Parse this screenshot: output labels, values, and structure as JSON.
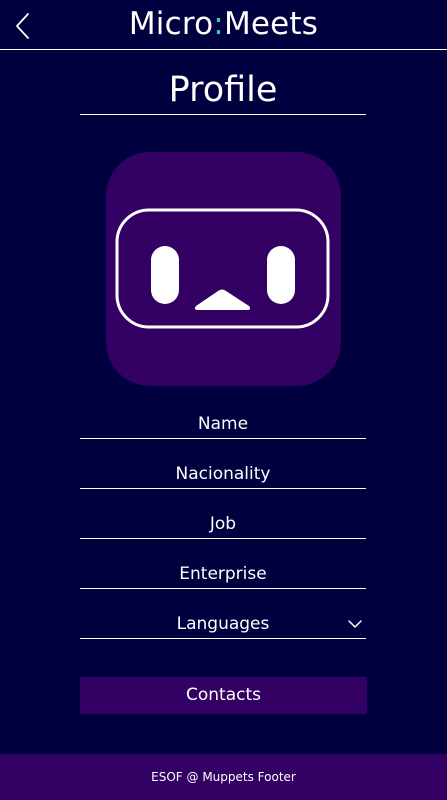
{
  "header": {
    "app_name_part1": "Micro",
    "app_name_colon": ":",
    "app_name_part2": "Meets",
    "back_icon": "chevron-left-icon"
  },
  "page": {
    "title": "Profile"
  },
  "avatar": {
    "icon": "robot-face-icon",
    "background_color": "#330064"
  },
  "fields": {
    "name": "Name",
    "nationality": "Nacionality",
    "job": "Job",
    "enterprise": "Enterprise",
    "languages": "Languages"
  },
  "contacts_button": {
    "label": "Contacts"
  },
  "footer": {
    "text": "ESOF @ Muppets Footer"
  },
  "colors": {
    "background": "#01003f",
    "accent": "#27d3be",
    "purple": "#330064"
  }
}
